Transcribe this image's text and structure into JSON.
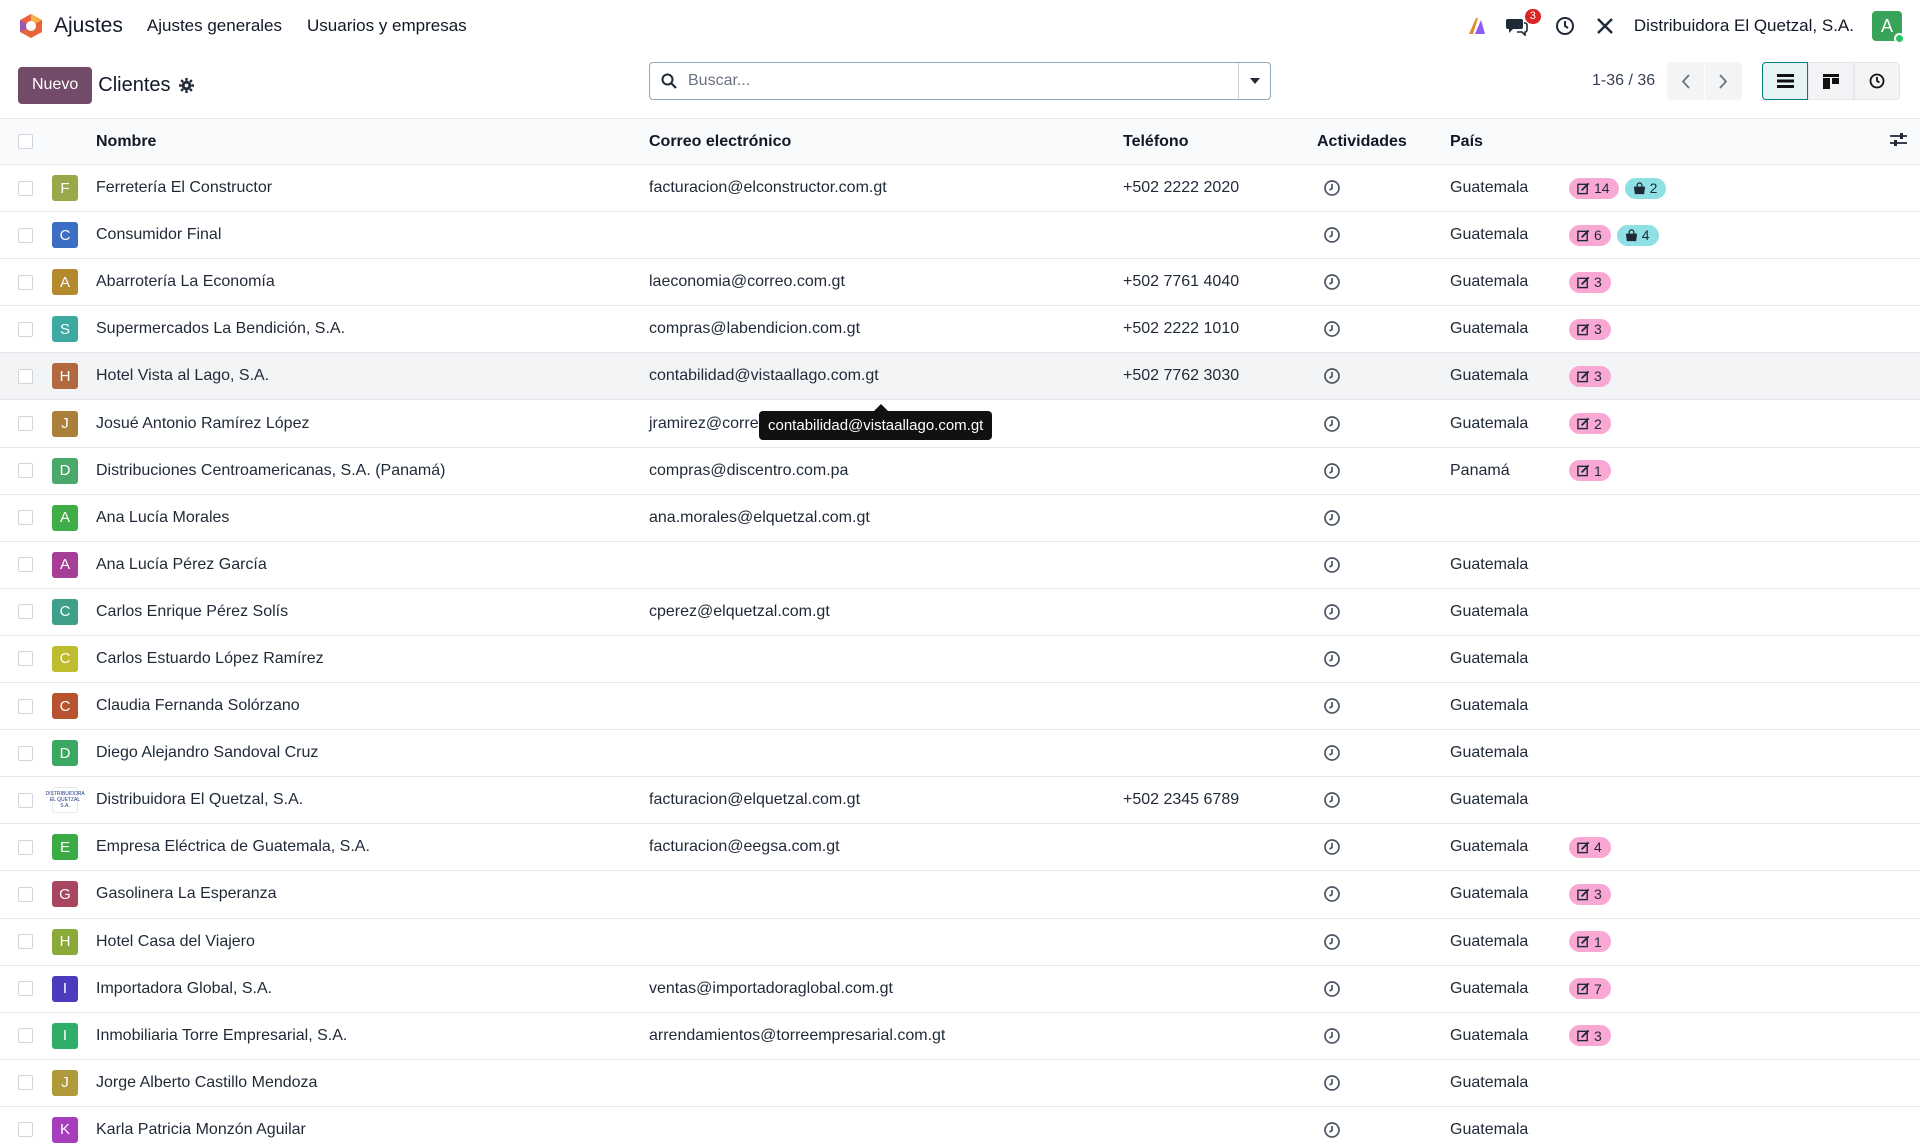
{
  "navbar": {
    "app_name": "Ajustes",
    "menu": [
      "Ajustes generales",
      "Usuarios y empresas"
    ],
    "messages_count": "3",
    "company": "Distribuidora El Quetzal, S.A.",
    "user_initial": "A"
  },
  "control": {
    "new_button": "Nuevo",
    "breadcrumb": "Clientes",
    "search_placeholder": "Buscar...",
    "pager": "1-36 / 36"
  },
  "table": {
    "headers": {
      "name": "Nombre",
      "email": "Correo electrónico",
      "phone": "Teléfono",
      "activities": "Actividades",
      "country": "País"
    },
    "rows": [
      {
        "initial": "F",
        "color": "#9aa84a",
        "name": "Ferretería El Constructor",
        "email": "facturacion@elconstructor.com.gt",
        "phone": "+502 2222 2020",
        "country": "Guatemala",
        "badges": [
          {
            "type": "pink",
            "icon": "edit-icon",
            "value": "14"
          },
          {
            "type": "teal",
            "icon": "bag-icon",
            "value": "2"
          }
        ]
      },
      {
        "initial": "C",
        "color": "#3b6fc4",
        "name": "Consumidor Final",
        "email": "",
        "phone": "",
        "country": "Guatemala",
        "badges": [
          {
            "type": "pink",
            "icon": "edit-icon",
            "value": "6"
          },
          {
            "type": "teal",
            "icon": "bag-icon",
            "value": "4"
          }
        ]
      },
      {
        "initial": "A",
        "color": "#b58a2e",
        "name": "Abarrotería La Economía",
        "email": "laeconomia@correo.com.gt",
        "phone": "+502 7761 4040",
        "country": "Guatemala",
        "badges": [
          {
            "type": "pink",
            "icon": "edit-icon",
            "value": "3"
          }
        ]
      },
      {
        "initial": "S",
        "color": "#3ea9a0",
        "name": "Supermercados La Bendición, S.A.",
        "email": "compras@labendicion.com.gt",
        "phone": "+502 2222 1010",
        "country": "Guatemala",
        "badges": [
          {
            "type": "pink",
            "icon": "edit-icon",
            "value": "3"
          }
        ]
      },
      {
        "initial": "H",
        "color": "#b16a40",
        "name": "Hotel Vista al Lago, S.A.",
        "email": "contabilidad@vistaallago.com.gt",
        "phone": "+502 7762 3030",
        "country": "Guatemala",
        "badges": [
          {
            "type": "pink",
            "icon": "edit-icon",
            "value": "3"
          }
        ]
      },
      {
        "initial": "J",
        "color": "#a97f3a",
        "name": "Josué Antonio Ramírez López",
        "email": "jramirez@corre",
        "phone": "",
        "country": "Guatemala",
        "badges": [
          {
            "type": "pink",
            "icon": "edit-icon",
            "value": "2"
          }
        ]
      },
      {
        "initial": "D",
        "color": "#4aa86a",
        "name": "Distribuciones Centroamericanas, S.A. (Panamá)",
        "email": "compras@discentro.com.pa",
        "phone": "",
        "country": "Panamá",
        "badges": [
          {
            "type": "pink",
            "icon": "edit-icon",
            "value": "1"
          }
        ]
      },
      {
        "initial": "A",
        "color": "#3fae46",
        "name": "Ana Lucía Morales",
        "email": "ana.morales@elquetzal.com.gt",
        "phone": "",
        "country": "",
        "badges": []
      },
      {
        "initial": "A",
        "color": "#a63d96",
        "name": "Ana Lucía Pérez García",
        "email": "",
        "phone": "",
        "country": "Guatemala",
        "badges": []
      },
      {
        "initial": "C",
        "color": "#3ea08a",
        "name": "Carlos Enrique Pérez Solís",
        "email": "cperez@elquetzal.com.gt",
        "phone": "",
        "country": "Guatemala",
        "badges": []
      },
      {
        "initial": "C",
        "color": "#bdbd2e",
        "name": "Carlos Estuardo López Ramírez",
        "email": "",
        "phone": "",
        "country": "Guatemala",
        "badges": []
      },
      {
        "initial": "C",
        "color": "#b8532f",
        "name": "Claudia Fernanda Solórzano",
        "email": "",
        "phone": "",
        "country": "Guatemala",
        "badges": []
      },
      {
        "initial": "D",
        "color": "#3aa860",
        "name": "Diego Alejandro Sandoval Cruz",
        "email": "",
        "phone": "",
        "country": "Guatemala",
        "badges": []
      },
      {
        "initial": "DISTRIBUIDORA EL QUETZAL S.A.",
        "color": "logo",
        "name": "Distribuidora El Quetzal, S.A.",
        "email": "facturacion@elquetzal.com.gt",
        "phone": "+502 2345 6789",
        "country": "Guatemala",
        "badges": []
      },
      {
        "initial": "E",
        "color": "#3aab45",
        "name": "Empresa Eléctrica de Guatemala, S.A.",
        "email": "facturacion@eegsa.com.gt",
        "phone": "",
        "country": "Guatemala",
        "badges": [
          {
            "type": "pink",
            "icon": "edit-icon",
            "value": "4"
          }
        ]
      },
      {
        "initial": "G",
        "color": "#a8465f",
        "name": "Gasolinera La Esperanza",
        "email": "",
        "phone": "",
        "country": "Guatemala",
        "badges": [
          {
            "type": "pink",
            "icon": "edit-icon",
            "value": "3"
          }
        ]
      },
      {
        "initial": "H",
        "color": "#8aab3a",
        "name": "Hotel Casa del Viajero",
        "email": "",
        "phone": "",
        "country": "Guatemala",
        "badges": [
          {
            "type": "pink",
            "icon": "edit-icon",
            "value": "1"
          }
        ]
      },
      {
        "initial": "I",
        "color": "#4b3bbd",
        "name": "Importadora Global, S.A.",
        "email": "ventas@importadoraglobal.com.gt",
        "phone": "",
        "country": "Guatemala",
        "badges": [
          {
            "type": "pink",
            "icon": "edit-icon",
            "value": "7"
          }
        ]
      },
      {
        "initial": "I",
        "color": "#2fae6a",
        "name": "Inmobiliaria Torre Empresarial, S.A.",
        "email": "arrendamientos@torreempresarial.com.gt",
        "phone": "",
        "country": "Guatemala",
        "badges": [
          {
            "type": "pink",
            "icon": "edit-icon",
            "value": "3"
          }
        ]
      },
      {
        "initial": "J",
        "color": "#b09a3a",
        "name": "Jorge Alberto Castillo Mendoza",
        "email": "",
        "phone": "",
        "country": "Guatemala",
        "badges": []
      },
      {
        "initial": "K",
        "color": "#a63dbd",
        "name": "Karla Patricia Monzón Aguilar",
        "email": "",
        "phone": "",
        "country": "Guatemala",
        "badges": []
      }
    ]
  },
  "tooltip": "contabilidad@vistaallago.com.gt"
}
